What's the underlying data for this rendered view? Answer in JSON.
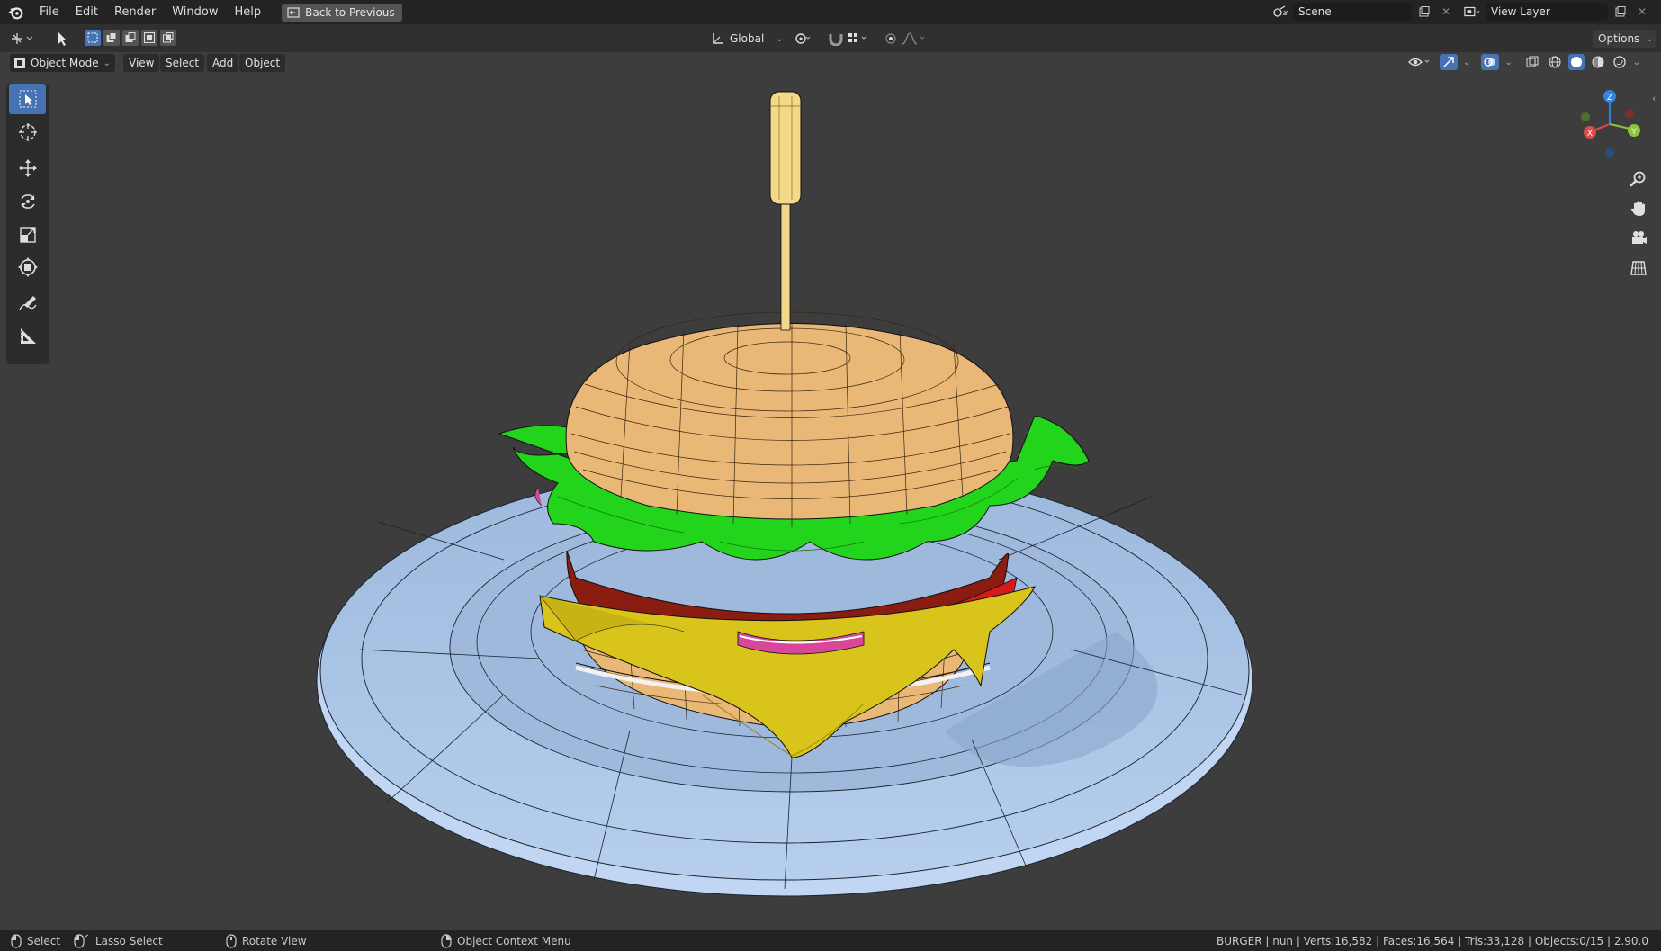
{
  "menu": {
    "items": [
      "File",
      "Edit",
      "Render",
      "Window",
      "Help"
    ],
    "back_button": "Back to Previous"
  },
  "scene": {
    "label": "Scene",
    "view_layer": "View Layer"
  },
  "header": {
    "transform_orientation": "Global",
    "options": "Options"
  },
  "viewport_header": {
    "mode": "Object Mode",
    "menus": [
      "View",
      "Select",
      "Add",
      "Object"
    ]
  },
  "gizmo": {
    "x": "X",
    "y": "Y",
    "z": "Z"
  },
  "status": {
    "select": "Select",
    "lasso": "Lasso Select",
    "rotate": "Rotate View",
    "context": "Object Context Menu",
    "stats": "BURGER | nun | Verts:16,582 | Faces:16,564 | Tris:33,128 | Objects:0/15 | 2.90.0"
  },
  "colors": {
    "accent": "#4772b3",
    "plate": "#a9c4e6",
    "bun": "#e9b877",
    "lettuce": "#22d41c",
    "cheese": "#d8c41a",
    "tomato": "#d41a1a",
    "patty": "#8a1c12",
    "onion": "#d9479b"
  },
  "icons": [
    "blender-logo-icon",
    "back-icon",
    "scene-icon",
    "view-layer-icon",
    "select-box-icon",
    "cursor-icon",
    "move-icon",
    "rotate-icon",
    "scale-icon",
    "transform-icon",
    "annotate-icon",
    "measure-icon",
    "zoom-icon",
    "hand-icon",
    "camera-icon",
    "grid-icon"
  ]
}
